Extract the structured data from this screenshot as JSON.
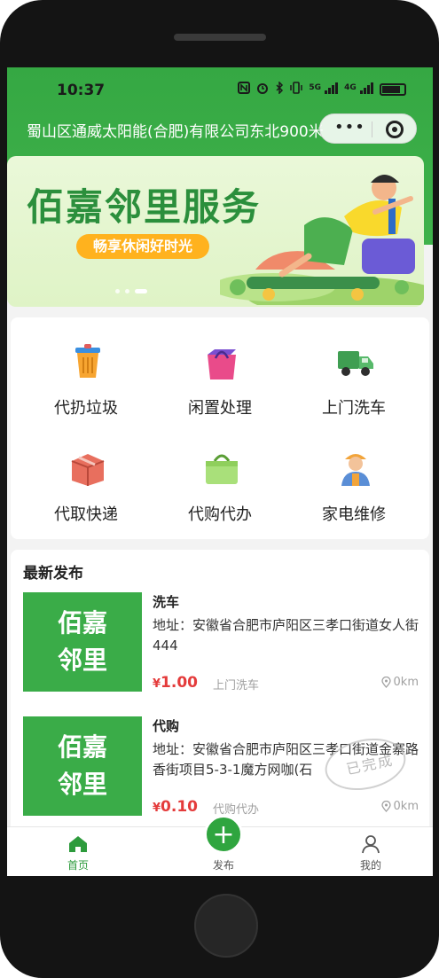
{
  "status_bar": {
    "time": "10:37",
    "icons": [
      "nfc-icon",
      "alarm-icon",
      "bluetooth-icon",
      "vibrate-icon",
      "5g-signal-icon",
      "4g-signal-icon",
      "battery-icon"
    ],
    "net_5g": "5G",
    "net_4g": "4G"
  },
  "header": {
    "location": "蜀山区通威太阳能(合肥)有限公司东北900米",
    "capsule_more": "•••",
    "capsule_close": "target-icon"
  },
  "banner": {
    "title": "佰嘉邻里服务",
    "subtitle": "畅享休闲好时光",
    "slide_count": 3,
    "active_slide": 3
  },
  "services": [
    {
      "label": "代扔垃圾",
      "icon": "trash-bin-icon"
    },
    {
      "label": "闲置处理",
      "icon": "shopping-bag-icon"
    },
    {
      "label": "上门洗车",
      "icon": "truck-icon"
    },
    {
      "label": "代取快递",
      "icon": "package-box-icon"
    },
    {
      "label": "代购代办",
      "icon": "basket-icon"
    },
    {
      "label": "家电维修",
      "icon": "repairman-icon"
    }
  ],
  "latest": {
    "title": "最新发布",
    "posts": [
      {
        "thumb_line1": "佰嘉",
        "thumb_line2": "邻里",
        "title": "洗车",
        "address": "地址：安徽省合肥市庐阳区三孝口街道女人街444",
        "currency": "¥",
        "price": "1.00",
        "type": "上门洗车",
        "distance": "0km"
      },
      {
        "thumb_line1": "佰嘉",
        "thumb_line2": "邻里",
        "title": "代购",
        "address": "地址：安徽省合肥市庐阳区三孝口街道金寨路香街项目5-3-1魔方网咖(石",
        "currency": "¥",
        "price": "0.10",
        "type": "代购代办",
        "distance": "0km"
      }
    ],
    "stamp_text": "已完成"
  },
  "tabbar": {
    "home": "首页",
    "post": "发布",
    "post_symbol": "+",
    "mine": "我的",
    "active": "home"
  },
  "colors": {
    "brand_green": "#3aac48",
    "price_red": "#e43b3b",
    "banner_orange": "#ffb21e"
  }
}
